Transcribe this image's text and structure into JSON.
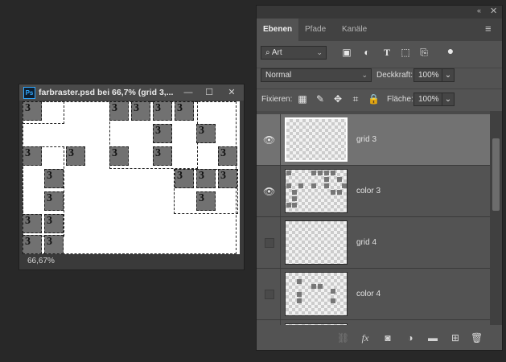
{
  "document": {
    "app_icon_label": "Ps",
    "title": "farbraster.psd bei 66,7% (grid 3,...",
    "minimize_glyph": "—",
    "maximize_glyph": "☐",
    "close_glyph": "✕",
    "zoom": "66,67%",
    "cell_label": "3"
  },
  "panel": {
    "collapse_glyph": "«",
    "close_glyph": "✕",
    "menu_glyph": "≡",
    "tabs": [
      "Ebenen",
      "Pfade",
      "Kanäle"
    ],
    "filter_kind": "Art",
    "filter_chevron": "⌄",
    "filter_icons": [
      "image-filter-icon",
      "adjustment-filter-icon",
      "type-filter-icon",
      "shape-filter-icon",
      "smartobject-filter-icon"
    ],
    "blend_mode": "Normal",
    "opacity_label": "Deckkraft:",
    "opacity_value": "100%",
    "lock_label": "Fixieren:",
    "fill_label": "Fläche:",
    "fill_value": "100%",
    "eye_glyph": "👁",
    "layers": [
      {
        "name": "grid 3",
        "visible": true,
        "selected": true
      },
      {
        "name": "color 3",
        "visible": true,
        "selected": false
      },
      {
        "name": "grid 4",
        "visible": false,
        "selected": false
      },
      {
        "name": "color 4",
        "visible": false,
        "selected": false
      }
    ],
    "bottom_icons": [
      "link-icon",
      "fx-icon",
      "mask-icon",
      "adjustment-icon",
      "group-folder-icon",
      "new-layer-icon",
      "trash-icon"
    ]
  },
  "colors": {
    "accent": "#31a8ff",
    "cell_fill": "#717171"
  }
}
